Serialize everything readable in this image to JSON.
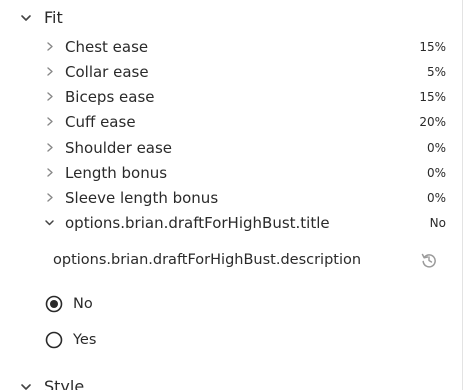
{
  "fit_section": {
    "title": "Fit",
    "icon": "chevron-down-icon",
    "options": [
      {
        "label": "Chest ease",
        "value": "15%",
        "icon": "chevron-right-icon"
      },
      {
        "label": "Collar ease",
        "value": "5%",
        "icon": "chevron-right-icon"
      },
      {
        "label": "Biceps ease",
        "value": "15%",
        "icon": "chevron-right-icon"
      },
      {
        "label": "Cuff ease",
        "value": "20%",
        "icon": "chevron-right-icon"
      },
      {
        "label": "Shoulder ease",
        "value": "0%",
        "icon": "chevron-right-icon"
      },
      {
        "label": "Length bonus",
        "value": "0%",
        "icon": "chevron-right-icon"
      },
      {
        "label": "Sleeve length bonus",
        "value": "0%",
        "icon": "chevron-right-icon"
      }
    ],
    "expanded_option": {
      "label": "options.brian.draftForHighBust.title",
      "value": "No",
      "icon": "chevron-down-icon",
      "description": "options.brian.draftForHighBust.description",
      "reset_icon": "reset-icon",
      "choices": [
        {
          "label": "No",
          "selected": true
        },
        {
          "label": "Yes",
          "selected": false
        }
      ]
    }
  },
  "style_section": {
    "title": "Style",
    "icon": "chevron-down-icon"
  },
  "colors": {
    "text": "#2a2a2a",
    "muted_icon": "#9a9a9a",
    "divider": "#e3e3e3"
  }
}
